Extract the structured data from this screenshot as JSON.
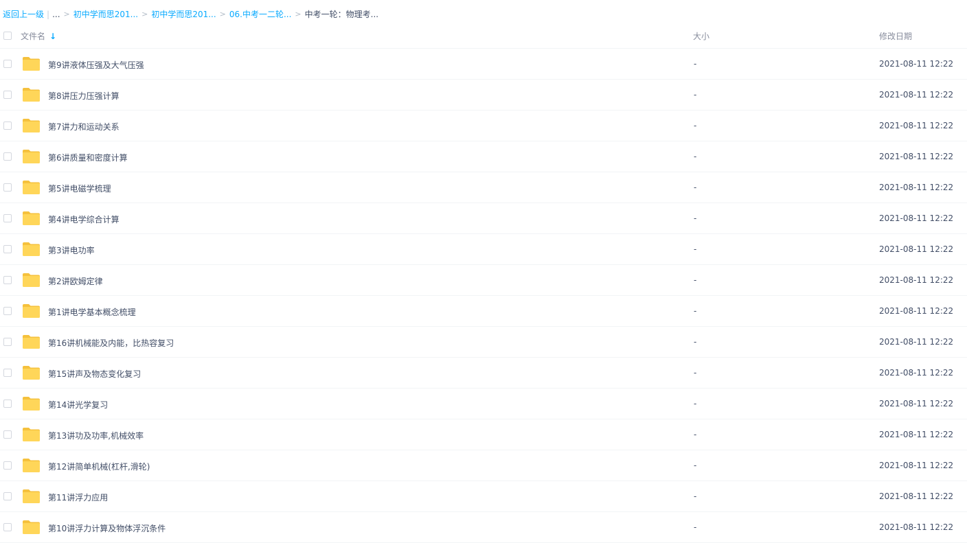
{
  "breadcrumb": {
    "back": "返回上一级",
    "ellipsis": "...",
    "items": [
      "初中学而思201...",
      "初中学而思201...",
      "06.中考一二轮..."
    ],
    "current": "中考一轮：物理考..."
  },
  "header": {
    "name": "文件名",
    "size": "大小",
    "date": "修改日期"
  },
  "rows": [
    {
      "name": "第9讲液体压强及大气压强",
      "size": "-",
      "date": "2021-08-11 12:22"
    },
    {
      "name": "第8讲压力压强计算",
      "size": "-",
      "date": "2021-08-11 12:22"
    },
    {
      "name": "第7讲力和运动关系",
      "size": "-",
      "date": "2021-08-11 12:22"
    },
    {
      "name": "第6讲质量和密度计算",
      "size": "-",
      "date": "2021-08-11 12:22"
    },
    {
      "name": "第5讲电磁学梳理",
      "size": "-",
      "date": "2021-08-11 12:22"
    },
    {
      "name": "第4讲电学综合计算",
      "size": "-",
      "date": "2021-08-11 12:22"
    },
    {
      "name": "第3讲电功率",
      "size": "-",
      "date": "2021-08-11 12:22"
    },
    {
      "name": "第2讲欧姆定律",
      "size": "-",
      "date": "2021-08-11 12:22"
    },
    {
      "name": "第1讲电学基本概念梳理",
      "size": "-",
      "date": "2021-08-11 12:22"
    },
    {
      "name": "第16讲机械能及内能，比热容复习",
      "size": "-",
      "date": "2021-08-11 12:22"
    },
    {
      "name": "第15讲声及物态变化复习",
      "size": "-",
      "date": "2021-08-11 12:22"
    },
    {
      "name": "第14讲光学复习",
      "size": "-",
      "date": "2021-08-11 12:22"
    },
    {
      "name": "第13讲功及功率,机械效率",
      "size": "-",
      "date": "2021-08-11 12:22"
    },
    {
      "name": "第12讲简单机械(杠杆,滑轮)",
      "size": "-",
      "date": "2021-08-11 12:22"
    },
    {
      "name": "第11讲浮力应用",
      "size": "-",
      "date": "2021-08-11 12:22"
    },
    {
      "name": "第10讲浮力计算及物体浮沉条件",
      "size": "-",
      "date": "2021-08-11 12:22"
    }
  ],
  "icons": {
    "folder": "folder-icon",
    "sort": "arrow-down-icon"
  },
  "colors": {
    "link": "#09aaff",
    "folder": "#ffd659",
    "text": "#424e67"
  }
}
